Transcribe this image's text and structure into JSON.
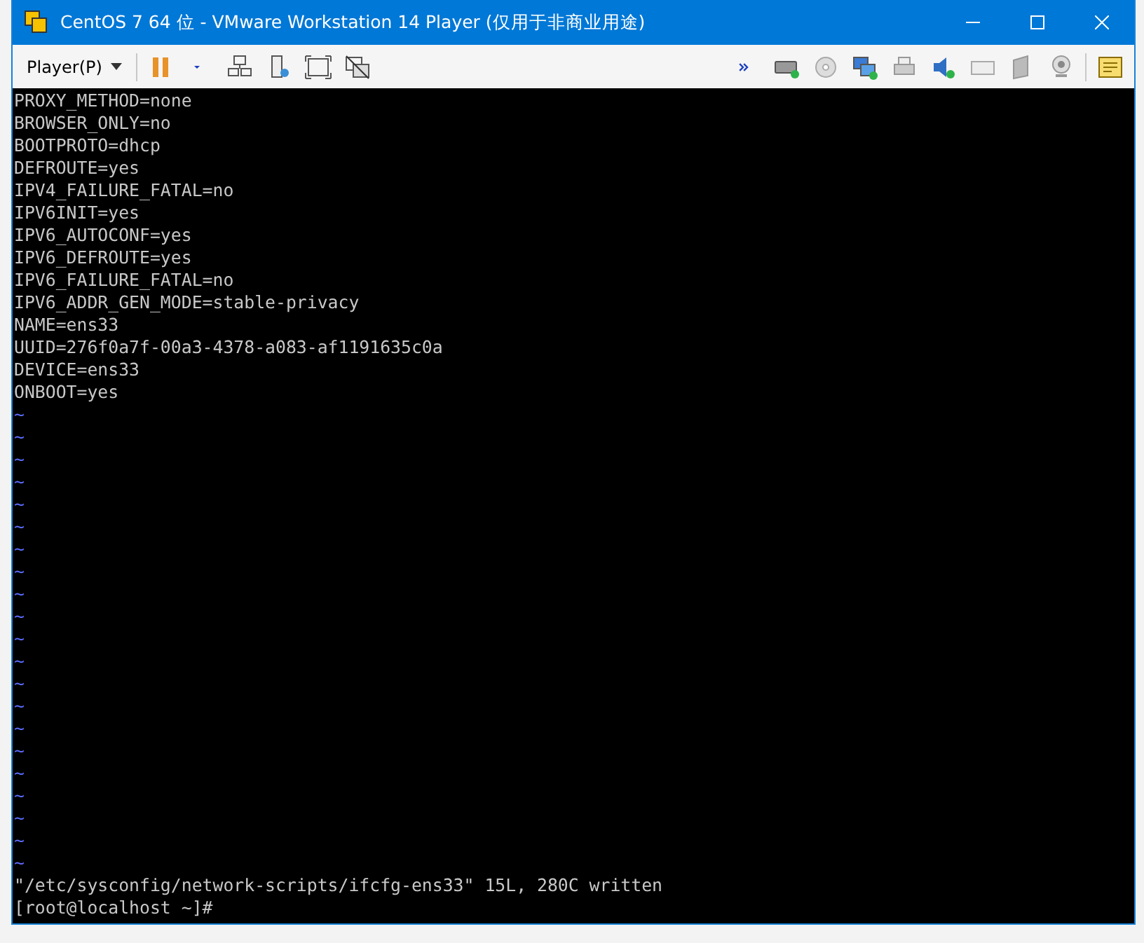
{
  "window": {
    "title": "CentOS 7 64 位 - VMware Workstation 14 Player (仅用于非商业用途)"
  },
  "toolbar": {
    "menu": "Player(P)"
  },
  "terminal": {
    "lines": [
      {
        "kind": "text",
        "text": "PROXY_METHOD=none"
      },
      {
        "kind": "text",
        "text": "BROWSER_ONLY=no"
      },
      {
        "kind": "text",
        "text": "BOOTPROTO=dhcp"
      },
      {
        "kind": "text",
        "text": "DEFROUTE=yes"
      },
      {
        "kind": "text",
        "text": "IPV4_FAILURE_FATAL=no"
      },
      {
        "kind": "text",
        "text": "IPV6INIT=yes"
      },
      {
        "kind": "text",
        "text": "IPV6_AUTOCONF=yes"
      },
      {
        "kind": "text",
        "text": "IPV6_DEFROUTE=yes"
      },
      {
        "kind": "text",
        "text": "IPV6_FAILURE_FATAL=no"
      },
      {
        "kind": "text",
        "text": "IPV6_ADDR_GEN_MODE=stable-privacy"
      },
      {
        "kind": "text",
        "text": "NAME=ens33"
      },
      {
        "kind": "text",
        "text": "UUID=276f0a7f-00a3-4378-a083-af1191635c0a"
      },
      {
        "kind": "text",
        "text": "DEVICE=ens33"
      },
      {
        "kind": "text",
        "text": "ONBOOT=yes"
      },
      {
        "kind": "tilde",
        "text": "~"
      },
      {
        "kind": "tilde",
        "text": "~"
      },
      {
        "kind": "tilde",
        "text": "~"
      },
      {
        "kind": "tilde",
        "text": "~"
      },
      {
        "kind": "tilde",
        "text": "~"
      },
      {
        "kind": "tilde",
        "text": "~"
      },
      {
        "kind": "tilde",
        "text": "~"
      },
      {
        "kind": "tilde",
        "text": "~"
      },
      {
        "kind": "tilde",
        "text": "~"
      },
      {
        "kind": "tilde",
        "text": "~"
      },
      {
        "kind": "tilde",
        "text": "~"
      },
      {
        "kind": "tilde",
        "text": "~"
      },
      {
        "kind": "tilde",
        "text": "~"
      },
      {
        "kind": "tilde",
        "text": "~"
      },
      {
        "kind": "tilde",
        "text": "~"
      },
      {
        "kind": "tilde",
        "text": "~"
      },
      {
        "kind": "tilde",
        "text": "~"
      },
      {
        "kind": "tilde",
        "text": "~"
      },
      {
        "kind": "tilde",
        "text": "~"
      },
      {
        "kind": "tilde",
        "text": "~"
      },
      {
        "kind": "tilde",
        "text": "~"
      },
      {
        "kind": "text",
        "text": "\"/etc/sysconfig/network-scripts/ifcfg-ens33\" 15L, 280C written"
      },
      {
        "kind": "text",
        "text": "[root@localhost ~]#"
      }
    ]
  }
}
